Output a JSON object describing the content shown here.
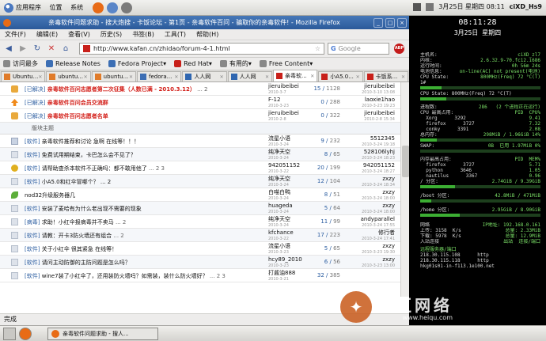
{
  "topbar": {
    "menus": [
      "应用程序",
      "位置",
      "系统"
    ],
    "datetime": "3月25日 星期四 08:11",
    "hostname": "ciXD_Hs9"
  },
  "window": {
    "title": "亲毒软件问题求助 - 搜大炮搜 - 卡饭论坛 - 第1页 - 亲毒软件百问 - 骗取你的亲毒软件! - Mozilla Firefox"
  },
  "menubar": [
    "文件(F)",
    "编辑(E)",
    "查看(V)",
    "历史(S)",
    "书签(B)",
    "工具(T)",
    "帮助(H)"
  ],
  "navbar": {
    "url": "http://www.kafan.cn/zhidao/forum-4-1.html",
    "search_placeholder": "Google"
  },
  "bookmarks": [
    "访问最多",
    "Release Notes",
    "Fedora Project",
    "Red Hat",
    "有用的",
    "Free Content"
  ],
  "tabs": [
    {
      "label": "Ubuntu...",
      "color": "#e07b2a"
    },
    {
      "label": "ubuntu...",
      "color": "#e07b2a"
    },
    {
      "label": "ubuntu...",
      "color": "#e07b2a"
    },
    {
      "label": "fedora...",
      "color": "#3c6eb4"
    },
    {
      "label": "人人网",
      "color": "#2f66b0"
    },
    {
      "label": "人人网",
      "color": "#2f66b0"
    },
    {
      "label": "亲毒软...",
      "color": "#c8201a",
      "active": true
    },
    {
      "label": "小A5.0...",
      "color": "#c8201a"
    },
    {
      "label": "卡饭系...",
      "color": "#c8201a"
    }
  ],
  "threads_top": [
    {
      "icon": "lock",
      "tag": "[已解决]",
      "title": "亲毒软件百问志愿者第二次征集（人数已满 - 2010.3.12）",
      "red": true,
      "pages": "... 2",
      "author": "jieruibeibei",
      "adate": "2010-3-7",
      "replies": "15",
      "views": "1128",
      "last": "jieruibeibei",
      "ldate": "2010-3-10 13:08"
    },
    {
      "icon": "up",
      "tag": "[已解决]",
      "title": "亲毒软件百问会员交流群",
      "red": true,
      "pages": "",
      "author": "F-12",
      "adate": "2010-3-23",
      "replies": "0",
      "views": "288",
      "last": "laoxie1hao",
      "ldate": "2010-3-23 19:23"
    },
    {
      "icon": "lock",
      "tag": "[已解决]",
      "title": "亲毒软件百问志愿者名单",
      "red": true,
      "pages": "",
      "author": "jieruibeibei",
      "adate": "2010-2-8",
      "replies": "0",
      "views": "322",
      "last": "jieruibeibei",
      "ldate": "2010-2-8 15:34"
    }
  ],
  "section_label": "版块主题",
  "threads": [
    {
      "icon": "new",
      "tag": "[软件]",
      "title": "亲毒软件推荐和讨论 急啊 在线等！！！",
      "pages": "",
      "author": "流星小语",
      "adate": "2010-3-24",
      "replies": "9",
      "views": "232",
      "last": "5512345",
      "ldate": "2010-3-24 19:18"
    },
    {
      "icon": "normal",
      "tag": "[软件]",
      "title": "免费试用期结束，卡巴怎么会不见了？",
      "pages": "",
      "author": "纯净天空",
      "adate": "2010-3-24",
      "replies": "8",
      "views": "65",
      "last": "528106lyhj",
      "ldate": "2010-3-24 18:23"
    },
    {
      "icon": "hot",
      "tag": "[软件]",
      "title": "请帮助查杀本软件不正确吗：都不敢用他了",
      "pages": "... 2  3",
      "author": "942051152",
      "adate": "2010-3-22",
      "replies": "20",
      "views": "199",
      "last": "942051152",
      "ldate": "2010-3-24 18:27"
    },
    {
      "icon": "normal",
      "tag": "[软件]",
      "title": "小A5.0和红伞冒哪个？ ... 2",
      "pages": "",
      "author": "纯净天空",
      "adate": "2010-3-24",
      "replies": "12",
      "views": "104",
      "last": "zxzy",
      "ldate": "2010-3-24 18:34"
    },
    {
      "icon": "leaf",
      "tag": "",
      "title": "nod32升级服务器几",
      "pages": "",
      "author": "白喵白鸭",
      "adate": "2010-3-24",
      "replies": "8",
      "views": "51",
      "last": "zxzy",
      "ldate": "2010-3-24 18:00"
    },
    {
      "icon": "normal",
      "tag": "[软件]",
      "title": "安装了麦哈有为什么老出现不需要的现象",
      "pages": "",
      "author": "huageda",
      "adate": "2010-3-24",
      "replies": "5",
      "views": "64",
      "last": "zxzy",
      "ldate": "2010-3-24 18:00"
    },
    {
      "icon": "normal",
      "tag": "[病毒]",
      "title": "求助！小红伞报病毒并不卖马",
      "pages": "... 2",
      "author": "纯净天空",
      "adate": "2010-3-24",
      "replies": "11",
      "views": "99",
      "last": "andyparallel",
      "ldate": "2010-3-24 17:55"
    },
    {
      "icon": "normal",
      "tag": "[软件]",
      "title": "请教：开卡3防火墙还有组合",
      "pages": "... 2",
      "author": "kfchance",
      "adate": "2010-3-22",
      "replies": "17",
      "views": "223",
      "last": "修行者",
      "ldate": "2010-3-24 17:41"
    },
    {
      "icon": "normal",
      "tag": "[软件]",
      "title": "关于小红伞 很其紧急 在线等！",
      "pages": "",
      "author": "流星小语",
      "adate": "2010-3-23",
      "replies": "5",
      "views": "65",
      "last": "zxzy",
      "ldate": "2010-3-23 19:30"
    },
    {
      "icon": "normal",
      "tag": "[软件]",
      "title": "请问主动防御的主防问题是怎么吗？",
      "pages": "",
      "author": "hcy89_2010",
      "adate": "2010-3-23",
      "replies": "6",
      "views": "56",
      "last": "zxzy",
      "ldate": "2010-3-23 13:00"
    },
    {
      "icon": "normal",
      "tag": "[软件]",
      "title": "wine7装了小红伞了，还用装防火墙吗？如需装，装什么防火墙好？",
      "pages": "... 2  3",
      "author": "打酱油888",
      "adate": "2010-3-21",
      "replies": "32",
      "views": "385",
      "last": "",
      "ldate": ""
    }
  ],
  "status_text": "完成",
  "taskbar_task": "亲毒软件问题求助 - 搜人...",
  "conky": {
    "time": "08:11:28",
    "date": "3月25日 星期四",
    "lines": [
      {
        "label": "主机名:",
        "value": "ciXD_zl7"
      },
      {
        "label": "内核:",
        "value": "2.6.32.9-70.fc12.i686"
      },
      {
        "label": "运行时间:",
        "value": "0h 56m 24s"
      },
      {
        "label": "电池信息:",
        "value": "on-line(AC) not present(电池)"
      },
      {
        "label": "CPU State:",
        "value": "800MHz(Freq) 72 °C(T)"
      }
    ],
    "cpu1_label": "1#",
    "cpu1_pct": 0.18,
    "cpu2_label": "CPU State: 800MHz(Freq) 72 °C(T)",
    "cpu2_pct": 0.22,
    "proc_header": {
      "label": "进程数:",
      "value": "286   (2 个进程正在运行)"
    },
    "cpu_head": {
      "a": "CPU 最高占用:",
      "b": "PID  CPU%"
    },
    "cpu_procs": [
      {
        "name": "Xorg",
        "pid": "3292",
        "val": "9.41"
      },
      {
        "name": "firefox",
        "pid": "3727",
        "val": "7.32"
      },
      {
        "name": "conky",
        "pid": "3391",
        "val": "2.08"
      }
    ],
    "mem_line": {
      "label": "总内存:",
      "value": "298MiB / 1.96GiB 14%"
    },
    "mem_pct": 0.14,
    "swap_line": {
      "label": "SWAP:",
      "value": "0B  已用 1.97MiB 0%"
    },
    "swap_pct": 0.0,
    "mem_head": {
      "a": "内存最高占用:",
      "b": "PID  MEM%"
    },
    "mem_procs": [
      {
        "name": "firefox",
        "pid": "3727",
        "val": "5.71"
      },
      {
        "name": "python",
        "pid": "3646",
        "val": "1.05"
      },
      {
        "name": "nautilus",
        "pid": "3367",
        "val": "0.96"
      }
    ],
    "root_line": {
      "label": "/ 分区:",
      "value": "2.74GiB / 9.39GiB"
    },
    "root_pct": 0.29,
    "boot_line": {
      "label": "/boot 分区:",
      "value": "42.8MiB / 471MiB"
    },
    "boot_pct": 0.09,
    "home_line": {
      "label": "/home 分区:",
      "value": "2.95GiB / 8.90GiB"
    },
    "home_pct": 0.33,
    "net_line": {
      "label": "网络",
      "value": "IP地址: 192.168.0.161"
    },
    "down_line": {
      "label": "上传: 3158  K/s",
      "value": "总量: 2.33MiB"
    },
    "up_line": {
      "label": "下载: 5978  K/s",
      "value": "总量: 12.9MiB"
    },
    "conn_line": {
      "label": "入站连接",
      "value": "出站  连接/端口"
    },
    "remote_title": "远程服务器/端口",
    "remote_lines": [
      "218.30.115.108      http",
      "218.30.115.118      http",
      "hkg01s01-in-f113.1e100.net"
    ]
  },
  "watermark": {
    "title": "黑区网络",
    "url": "www.heiqu.com"
  }
}
